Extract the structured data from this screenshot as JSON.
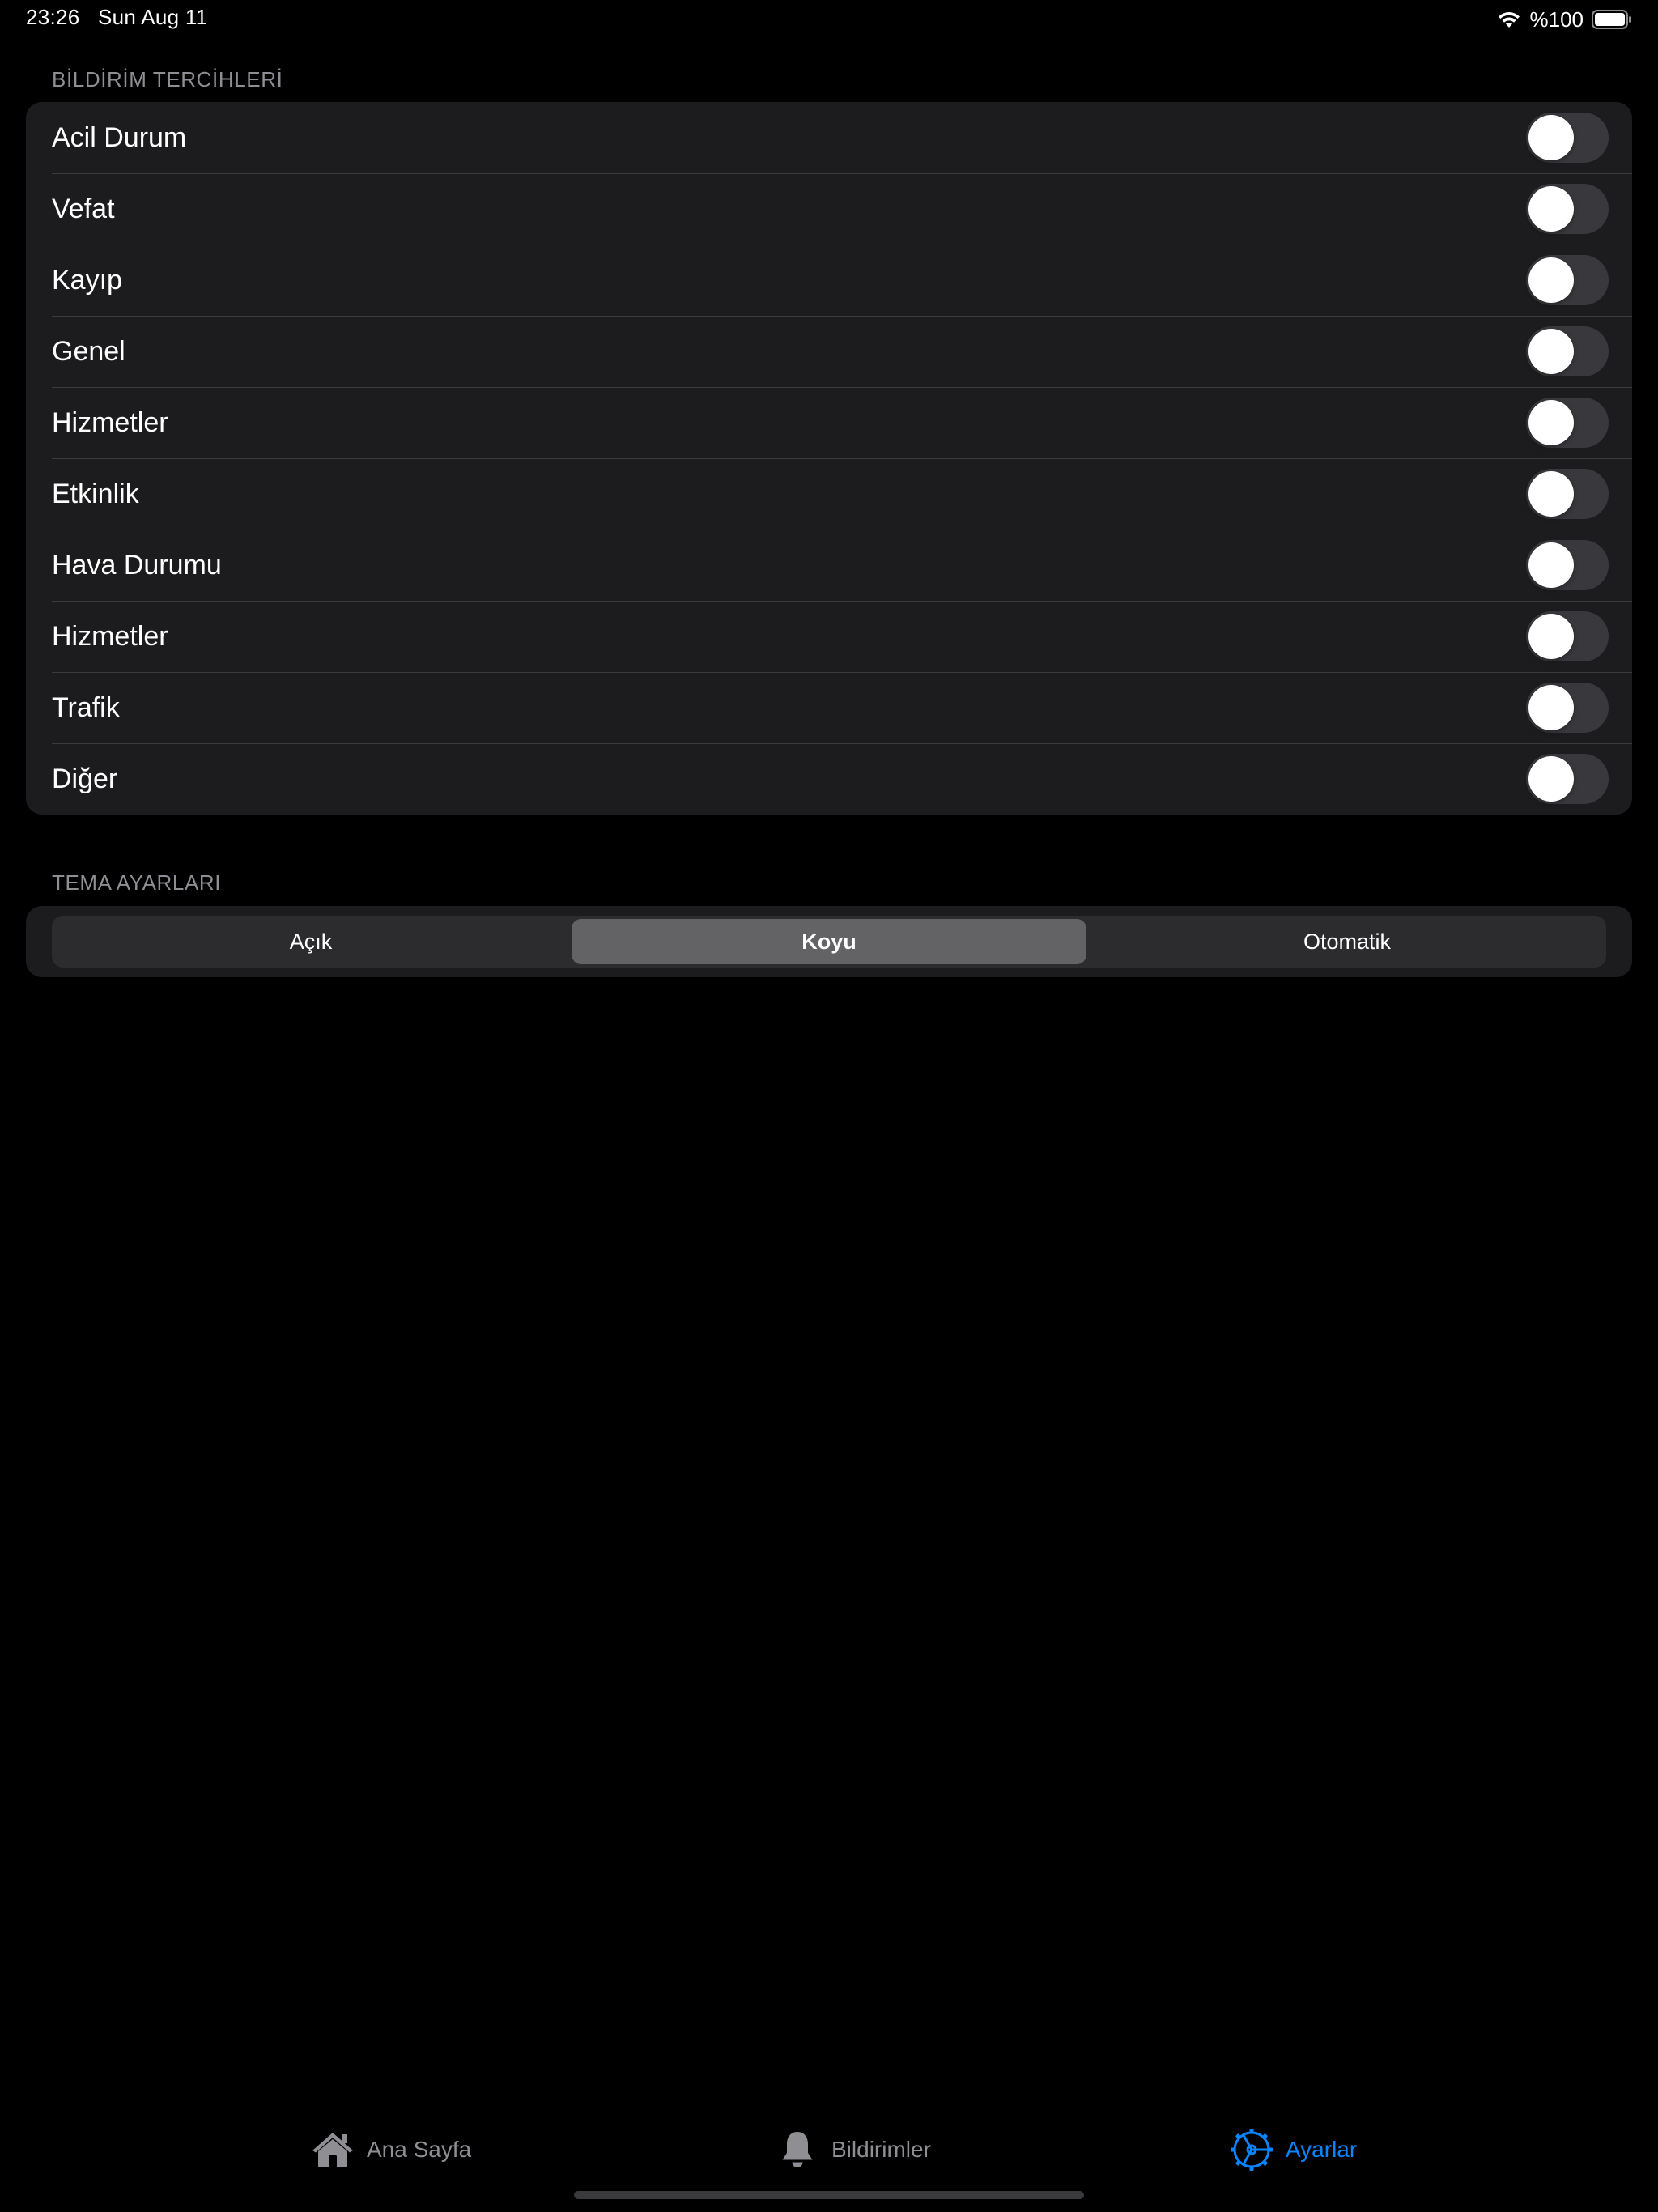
{
  "status_bar": {
    "time": "23:26",
    "date": "Sun Aug 11",
    "battery_text": "%100",
    "icons": [
      "wifi-icon",
      "battery-icon"
    ]
  },
  "notifications": {
    "header": "BİLDİRİM TERCİHLERİ",
    "items": [
      {
        "label": "Acil Durum",
        "enabled": false
      },
      {
        "label": "Vefat",
        "enabled": false
      },
      {
        "label": "Kayıp",
        "enabled": false
      },
      {
        "label": "Genel",
        "enabled": false
      },
      {
        "label": "Hizmetler",
        "enabled": false
      },
      {
        "label": "Etkinlik",
        "enabled": false
      },
      {
        "label": "Hava Durumu",
        "enabled": false
      },
      {
        "label": "Hizmetler",
        "enabled": false
      },
      {
        "label": "Trafik",
        "enabled": false
      },
      {
        "label": "Diğer",
        "enabled": false
      }
    ]
  },
  "theme": {
    "header": "TEMA AYARLARI",
    "options": [
      "Açık",
      "Koyu",
      "Otomatik"
    ],
    "selected": "Koyu"
  },
  "tab_bar": {
    "items": [
      {
        "label": "Ana Sayfa",
        "icon": "home-icon",
        "active": false
      },
      {
        "label": "Bildirimler",
        "icon": "bell-icon",
        "active": false
      },
      {
        "label": "Ayarlar",
        "icon": "gear-icon",
        "active": true
      }
    ]
  },
  "colors": {
    "background": "#000000",
    "card": "#1c1c1e",
    "accent": "#0a84ff",
    "secondary_text": "#8e8e93",
    "switch_off": "#39393d",
    "segment_selected": "#636366"
  }
}
